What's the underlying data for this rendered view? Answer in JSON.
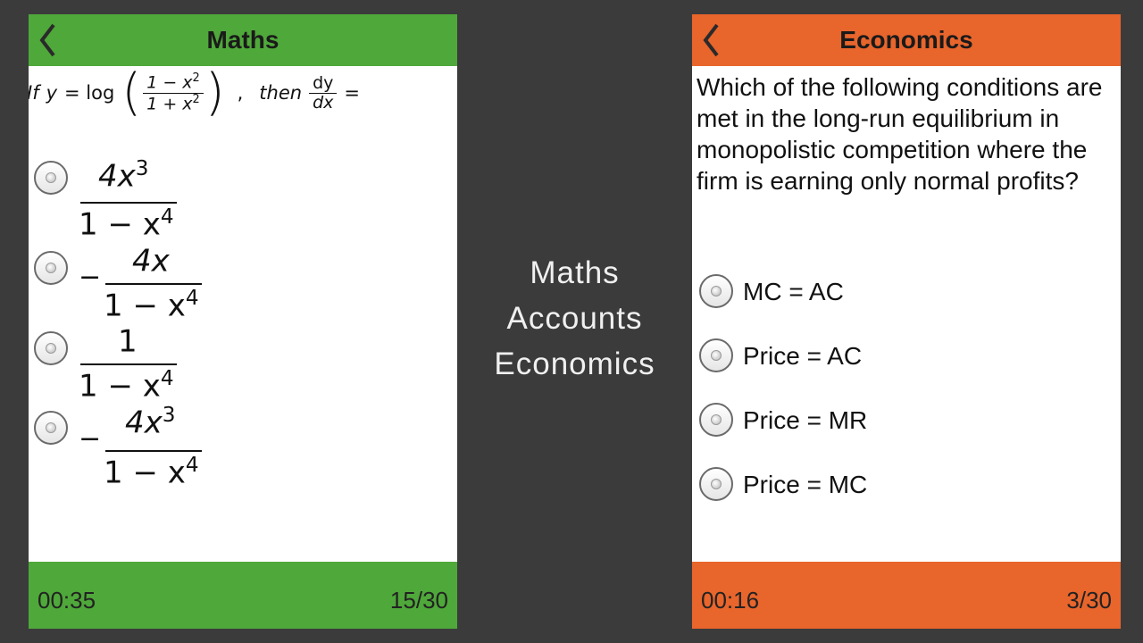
{
  "maths": {
    "title": "Maths",
    "question": {
      "prefix": "If",
      "y": "y",
      "eq": "= log",
      "frac_num": "1 − x",
      "frac_num_exp": "2",
      "frac_den": "1 + x",
      "frac_den_exp": "2",
      "comma": ",",
      "then": "then",
      "dy": "dy",
      "dx": "dx",
      "tail": "="
    },
    "options": [
      {
        "sign": "",
        "num": "4x",
        "num_exp": "3",
        "den": "1 − x",
        "den_exp": "4"
      },
      {
        "sign": "−",
        "num": "4x",
        "num_exp": "",
        "den": "1 − x",
        "den_exp": "4"
      },
      {
        "sign": "",
        "num": "1",
        "num_exp": "",
        "den": "1 − x",
        "den_exp": "4"
      },
      {
        "sign": "−",
        "num": "4x",
        "num_exp": "3",
        "den": "1 − x",
        "den_exp": "4"
      }
    ],
    "timer": "00:35",
    "progress": "15/30",
    "color": "#4fa83a"
  },
  "menu": {
    "items": [
      "Maths",
      "Accounts",
      "Economics"
    ]
  },
  "economics": {
    "title": "Economics",
    "question": "Which of the following conditions are met in the long-run equilibrium in monopolistic competition where the firm is earning only normal profits?",
    "options": [
      "MC = AC",
      "Price = AC",
      "Price = MR",
      "Price = MC"
    ],
    "timer": "00:16",
    "progress": "3/30",
    "color": "#e8652c"
  }
}
